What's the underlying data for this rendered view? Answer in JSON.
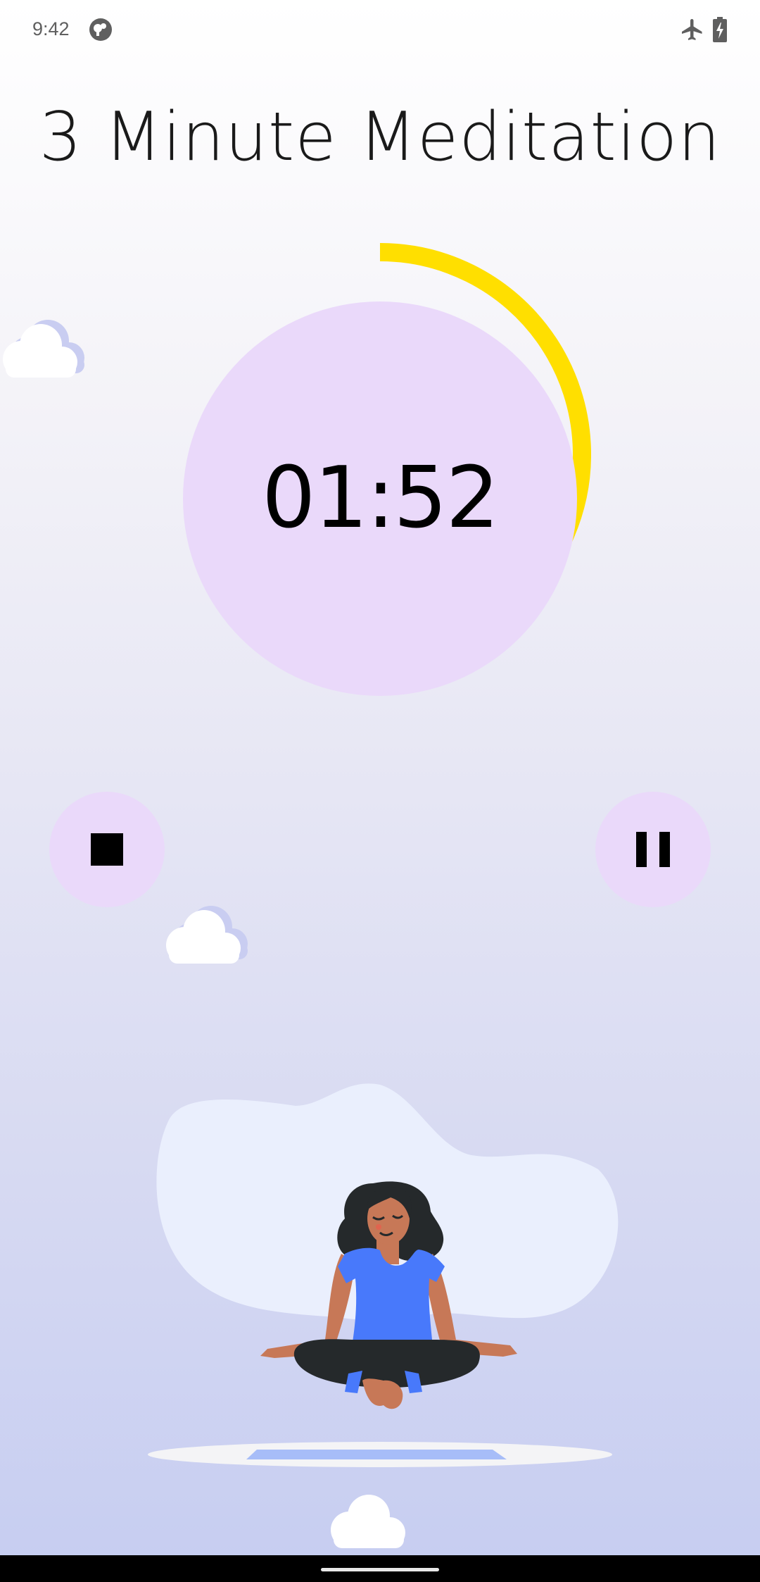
{
  "status_bar": {
    "time": "9:42",
    "app_icon": "notification-app-icon",
    "airplane_icon": "airplane-icon",
    "battery_icon": "battery-charging-icon"
  },
  "page": {
    "title": "3 Minute Meditation"
  },
  "timer": {
    "display": "01:52",
    "progress_fraction": 0.63,
    "ring_color": "#ffdf00",
    "circle_color": "#ead9fa"
  },
  "controls": {
    "stop_icon": "stop-icon",
    "pause_icon": "pause-icon",
    "button_color": "#ead9fa"
  },
  "illustration": {
    "subject": "meditating-woman-illustration"
  },
  "navigation": {
    "handle": "gesture-nav-handle"
  }
}
